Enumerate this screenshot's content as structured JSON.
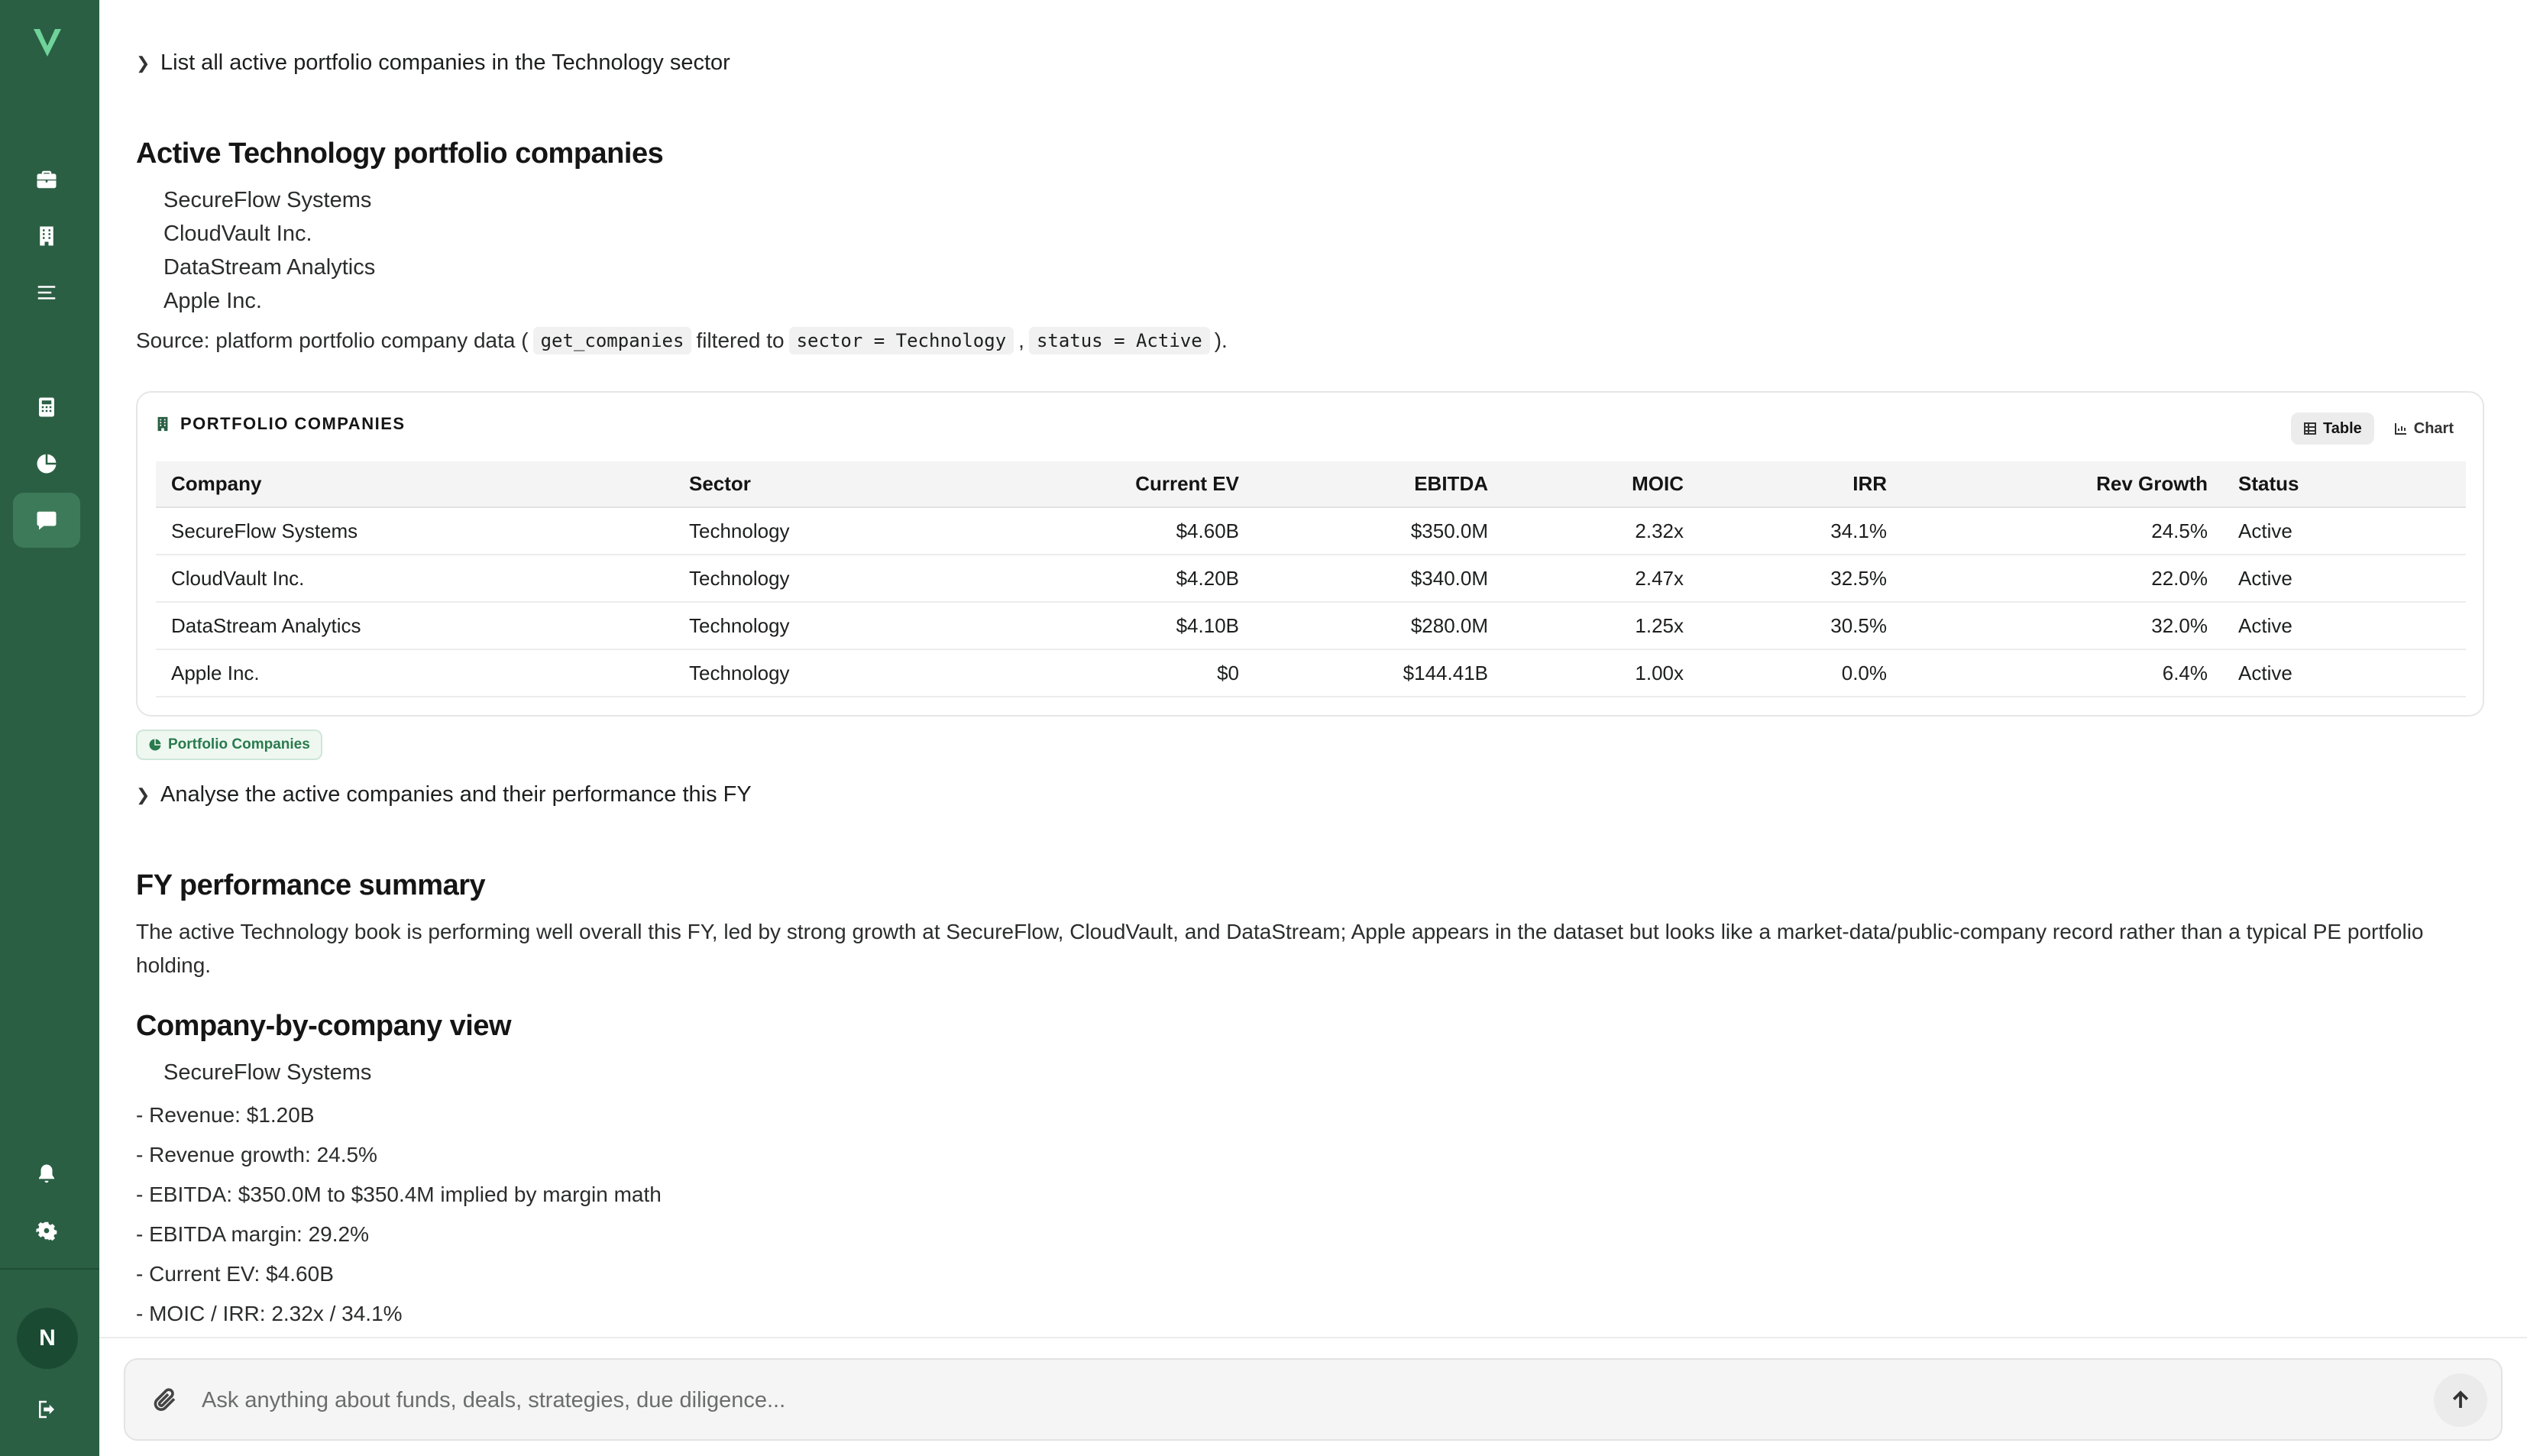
{
  "sidebar": {
    "logo": "V",
    "nav_icons": [
      "briefcase-icon",
      "building-icon",
      "list-icon",
      "calculator-icon",
      "pie-chart-icon",
      "chat-icon"
    ],
    "bottom_icons": [
      "bell-icon",
      "gear-icon",
      "logout-icon"
    ],
    "avatar_initial": "N",
    "accent": "#2a5f44"
  },
  "thread": {
    "query1": "List all active portfolio companies in the Technology sector",
    "heading1": "Active Technology portfolio companies",
    "companies": [
      "SecureFlow Systems",
      "CloudVault Inc.",
      "DataStream Analytics",
      "Apple Inc."
    ],
    "source": {
      "prefix": "Source: platform portfolio company data (",
      "code1": "get_companies",
      "mid": "filtered to",
      "code2": "sector = Technology",
      "comma": ",",
      "code3": "status = Active",
      "suffix": ")."
    },
    "card": {
      "title": "PORTFOLIO COMPANIES",
      "toggle_table": "Table",
      "toggle_chart": "Chart",
      "columns": [
        "Company",
        "Sector",
        "Current EV",
        "EBITDA",
        "MOIC",
        "IRR",
        "Rev Growth",
        "Status"
      ],
      "rows": [
        [
          "SecureFlow Systems",
          "Technology",
          "$4.60B",
          "$350.0M",
          "2.32x",
          "34.1%",
          "24.5%",
          "Active"
        ],
        [
          "CloudVault Inc.",
          "Technology",
          "$4.20B",
          "$340.0M",
          "2.47x",
          "32.5%",
          "22.0%",
          "Active"
        ],
        [
          "DataStream Analytics",
          "Technology",
          "$4.10B",
          "$280.0M",
          "1.25x",
          "30.5%",
          "32.0%",
          "Active"
        ],
        [
          "Apple Inc.",
          "Technology",
          "$0",
          "$144.41B",
          "1.00x",
          "0.0%",
          "6.4%",
          "Active"
        ]
      ]
    },
    "badge": "Portfolio Companies",
    "query2": "Analyse the active companies and their performance this FY",
    "heading2": "FY performance summary",
    "summary": "The active Technology book is performing well overall this FY, led by strong growth at SecureFlow, CloudVault, and DataStream; Apple appears in the dataset but looks like a market-data/public-company record rather than a typical PE portfolio holding.",
    "heading3": "Company-by-company view",
    "company_item": "SecureFlow Systems",
    "metrics": [
      "- Revenue: $1.20B",
      "- Revenue growth: 24.5%",
      "- EBITDA: $350.0M to $350.4M implied by margin math",
      "- EBITDA margin: 29.2%",
      "- Current EV: $4.60B",
      "- MOIC / IRR: 2.32x / 34.1%"
    ]
  },
  "input": {
    "placeholder": "Ask anything about funds, deals, strategies, due diligence..."
  }
}
